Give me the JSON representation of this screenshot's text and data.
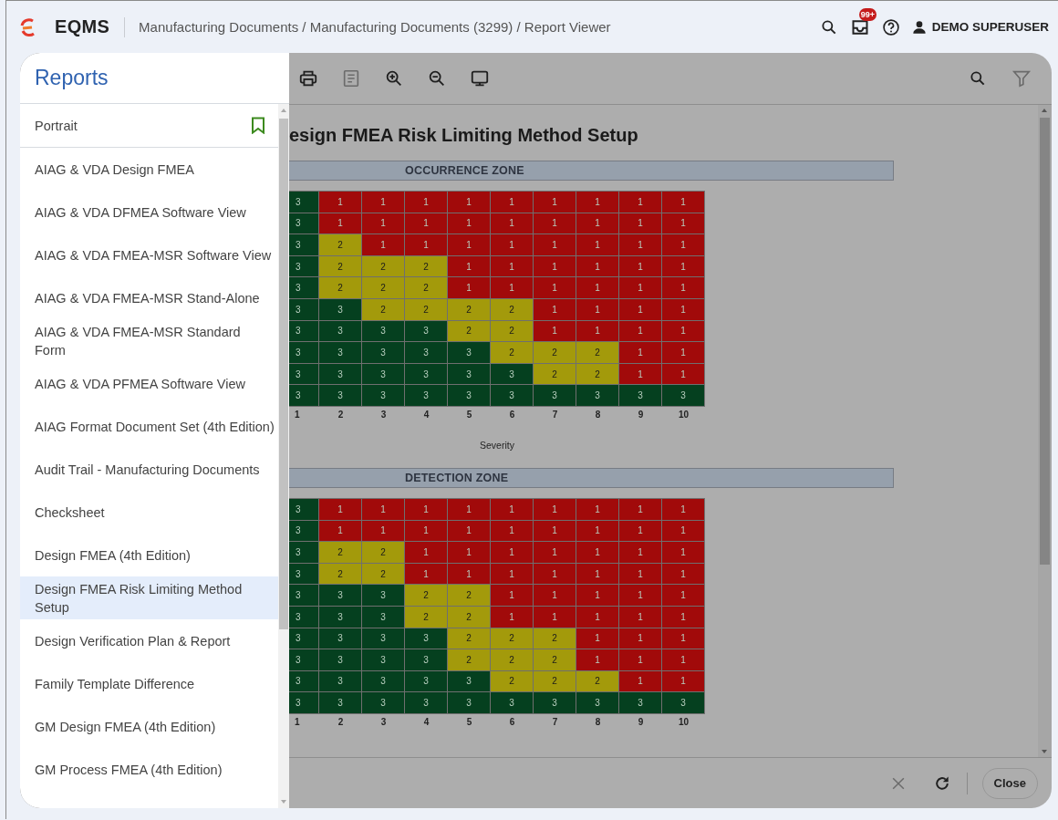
{
  "header": {
    "app_name": "EQMS",
    "breadcrumb": "Manufacturing Documents / Manufacturing Documents (3299) / Report Viewer",
    "notification_badge": "99+",
    "user_name": "DEMO SUPERUSER"
  },
  "reports_panel": {
    "title": "Reports",
    "orientation": "Portrait",
    "items": [
      {
        "label": "AIAG & VDA Design FMEA",
        "selected": false
      },
      {
        "label": "AIAG & VDA DFMEA Software View",
        "selected": false
      },
      {
        "label": "AIAG & VDA FMEA-MSR Software View",
        "selected": false
      },
      {
        "label": "AIAG & VDA FMEA-MSR Stand-Alone",
        "selected": false
      },
      {
        "label": "AIAG & VDA FMEA-MSR Standard Form",
        "selected": false
      },
      {
        "label": "AIAG & VDA PFMEA Software View",
        "selected": false
      },
      {
        "label": "AIAG Format Document Set (4th Edition)",
        "selected": false
      },
      {
        "label": "Audit Trail - Manufacturing Documents",
        "selected": false
      },
      {
        "label": "Checksheet",
        "selected": false
      },
      {
        "label": "Design FMEA (4th Edition)",
        "selected": false
      },
      {
        "label": "Design FMEA Risk Limiting Method Setup",
        "selected": true
      },
      {
        "label": "Design Verification Plan & Report",
        "selected": false
      },
      {
        "label": "Family Template Difference",
        "selected": false
      },
      {
        "label": "GM Design FMEA (4th Edition)",
        "selected": false
      },
      {
        "label": "GM Process FMEA (4th Edition)",
        "selected": false
      }
    ]
  },
  "report_viewer": {
    "toolbar": [
      {
        "kind": "print",
        "disabled": false
      },
      {
        "kind": "document",
        "disabled": true
      },
      {
        "kind": "zoom-in",
        "disabled": false
      },
      {
        "kind": "zoom-out",
        "disabled": false
      },
      {
        "kind": "monitor",
        "disabled": false
      }
    ],
    "toolbar_right": [
      {
        "kind": "search",
        "disabled": false
      },
      {
        "kind": "filter",
        "disabled": true
      }
    ],
    "title": "esign FMEA Risk Limiting Method Setup",
    "zones": [
      {
        "title": "OCCURRENCE ZONE",
        "axis_label": "Severity",
        "column_labels": [
          "1",
          "2",
          "3",
          "4",
          "5",
          "6",
          "7",
          "8",
          "9",
          "10"
        ],
        "rows": [
          [
            {
              "value": "3",
              "color": "#05401f"
            },
            {
              "value": "1",
              "color": "#a10a0a"
            },
            {
              "value": "1",
              "color": "#a10a0a"
            },
            {
              "value": "1",
              "color": "#a10a0a"
            },
            {
              "value": "1",
              "color": "#a10a0a"
            },
            {
              "value": "1",
              "color": "#a10a0a"
            },
            {
              "value": "1",
              "color": "#a10a0a"
            },
            {
              "value": "1",
              "color": "#a10a0a"
            },
            {
              "value": "1",
              "color": "#a10a0a"
            },
            {
              "value": "1",
              "color": "#a10a0a"
            }
          ],
          [
            {
              "value": "3",
              "color": "#05401f"
            },
            {
              "value": "1",
              "color": "#a10a0a"
            },
            {
              "value": "1",
              "color": "#a10a0a"
            },
            {
              "value": "1",
              "color": "#a10a0a"
            },
            {
              "value": "1",
              "color": "#a10a0a"
            },
            {
              "value": "1",
              "color": "#a10a0a"
            },
            {
              "value": "1",
              "color": "#a10a0a"
            },
            {
              "value": "1",
              "color": "#a10a0a"
            },
            {
              "value": "1",
              "color": "#a10a0a"
            },
            {
              "value": "1",
              "color": "#a10a0a"
            }
          ],
          [
            {
              "value": "3",
              "color": "#05401f"
            },
            {
              "value": "2",
              "color": "#a39a0b"
            },
            {
              "value": "1",
              "color": "#a10a0a"
            },
            {
              "value": "1",
              "color": "#a10a0a"
            },
            {
              "value": "1",
              "color": "#a10a0a"
            },
            {
              "value": "1",
              "color": "#a10a0a"
            },
            {
              "value": "1",
              "color": "#a10a0a"
            },
            {
              "value": "1",
              "color": "#a10a0a"
            },
            {
              "value": "1",
              "color": "#a10a0a"
            },
            {
              "value": "1",
              "color": "#a10a0a"
            }
          ],
          [
            {
              "value": "3",
              "color": "#05401f"
            },
            {
              "value": "2",
              "color": "#a39a0b"
            },
            {
              "value": "2",
              "color": "#a39a0b"
            },
            {
              "value": "2",
              "color": "#a39a0b"
            },
            {
              "value": "1",
              "color": "#a10a0a"
            },
            {
              "value": "1",
              "color": "#a10a0a"
            },
            {
              "value": "1",
              "color": "#a10a0a"
            },
            {
              "value": "1",
              "color": "#a10a0a"
            },
            {
              "value": "1",
              "color": "#a10a0a"
            },
            {
              "value": "1",
              "color": "#a10a0a"
            }
          ],
          [
            {
              "value": "3",
              "color": "#05401f"
            },
            {
              "value": "2",
              "color": "#a39a0b"
            },
            {
              "value": "2",
              "color": "#a39a0b"
            },
            {
              "value": "2",
              "color": "#a39a0b"
            },
            {
              "value": "1",
              "color": "#a10a0a"
            },
            {
              "value": "1",
              "color": "#a10a0a"
            },
            {
              "value": "1",
              "color": "#a10a0a"
            },
            {
              "value": "1",
              "color": "#a10a0a"
            },
            {
              "value": "1",
              "color": "#a10a0a"
            },
            {
              "value": "1",
              "color": "#a10a0a"
            }
          ],
          [
            {
              "value": "3",
              "color": "#05401f"
            },
            {
              "value": "3",
              "color": "#05401f"
            },
            {
              "value": "2",
              "color": "#a39a0b"
            },
            {
              "value": "2",
              "color": "#a39a0b"
            },
            {
              "value": "2",
              "color": "#a39a0b"
            },
            {
              "value": "2",
              "color": "#a39a0b"
            },
            {
              "value": "1",
              "color": "#a10a0a"
            },
            {
              "value": "1",
              "color": "#a10a0a"
            },
            {
              "value": "1",
              "color": "#a10a0a"
            },
            {
              "value": "1",
              "color": "#a10a0a"
            }
          ],
          [
            {
              "value": "3",
              "color": "#05401f"
            },
            {
              "value": "3",
              "color": "#05401f"
            },
            {
              "value": "3",
              "color": "#05401f"
            },
            {
              "value": "3",
              "color": "#05401f"
            },
            {
              "value": "2",
              "color": "#a39a0b"
            },
            {
              "value": "2",
              "color": "#a39a0b"
            },
            {
              "value": "1",
              "color": "#a10a0a"
            },
            {
              "value": "1",
              "color": "#a10a0a"
            },
            {
              "value": "1",
              "color": "#a10a0a"
            },
            {
              "value": "1",
              "color": "#a10a0a"
            }
          ],
          [
            {
              "value": "3",
              "color": "#05401f"
            },
            {
              "value": "3",
              "color": "#05401f"
            },
            {
              "value": "3",
              "color": "#05401f"
            },
            {
              "value": "3",
              "color": "#05401f"
            },
            {
              "value": "3",
              "color": "#05401f"
            },
            {
              "value": "2",
              "color": "#a39a0b"
            },
            {
              "value": "2",
              "color": "#a39a0b"
            },
            {
              "value": "2",
              "color": "#a39a0b"
            },
            {
              "value": "1",
              "color": "#a10a0a"
            },
            {
              "value": "1",
              "color": "#a10a0a"
            }
          ],
          [
            {
              "value": "3",
              "color": "#05401f"
            },
            {
              "value": "3",
              "color": "#05401f"
            },
            {
              "value": "3",
              "color": "#05401f"
            },
            {
              "value": "3",
              "color": "#05401f"
            },
            {
              "value": "3",
              "color": "#05401f"
            },
            {
              "value": "3",
              "color": "#05401f"
            },
            {
              "value": "2",
              "color": "#a39a0b"
            },
            {
              "value": "2",
              "color": "#a39a0b"
            },
            {
              "value": "1",
              "color": "#a10a0a"
            },
            {
              "value": "1",
              "color": "#a10a0a"
            }
          ],
          [
            {
              "value": "3",
              "color": "#05401f"
            },
            {
              "value": "3",
              "color": "#05401f"
            },
            {
              "value": "3",
              "color": "#05401f"
            },
            {
              "value": "3",
              "color": "#05401f"
            },
            {
              "value": "3",
              "color": "#05401f"
            },
            {
              "value": "3",
              "color": "#05401f"
            },
            {
              "value": "3",
              "color": "#05401f"
            },
            {
              "value": "3",
              "color": "#05401f"
            },
            {
              "value": "3",
              "color": "#05401f"
            },
            {
              "value": "3",
              "color": "#05401f"
            }
          ]
        ]
      },
      {
        "title": "DETECTION ZONE",
        "column_labels": [
          "1",
          "2",
          "3",
          "4",
          "5",
          "6",
          "7",
          "8",
          "9",
          "10"
        ],
        "rows": [
          [
            {
              "value": "3",
              "color": "#05401f"
            },
            {
              "value": "1",
              "color": "#a10a0a"
            },
            {
              "value": "1",
              "color": "#a10a0a"
            },
            {
              "value": "1",
              "color": "#a10a0a"
            },
            {
              "value": "1",
              "color": "#a10a0a"
            },
            {
              "value": "1",
              "color": "#a10a0a"
            },
            {
              "value": "1",
              "color": "#a10a0a"
            },
            {
              "value": "1",
              "color": "#a10a0a"
            },
            {
              "value": "1",
              "color": "#a10a0a"
            },
            {
              "value": "1",
              "color": "#a10a0a"
            }
          ],
          [
            {
              "value": "3",
              "color": "#05401f"
            },
            {
              "value": "1",
              "color": "#a10a0a"
            },
            {
              "value": "1",
              "color": "#a10a0a"
            },
            {
              "value": "1",
              "color": "#a10a0a"
            },
            {
              "value": "1",
              "color": "#a10a0a"
            },
            {
              "value": "1",
              "color": "#a10a0a"
            },
            {
              "value": "1",
              "color": "#a10a0a"
            },
            {
              "value": "1",
              "color": "#a10a0a"
            },
            {
              "value": "1",
              "color": "#a10a0a"
            },
            {
              "value": "1",
              "color": "#a10a0a"
            }
          ],
          [
            {
              "value": "3",
              "color": "#05401f"
            },
            {
              "value": "2",
              "color": "#a39a0b"
            },
            {
              "value": "2",
              "color": "#a39a0b"
            },
            {
              "value": "1",
              "color": "#a10a0a"
            },
            {
              "value": "1",
              "color": "#a10a0a"
            },
            {
              "value": "1",
              "color": "#a10a0a"
            },
            {
              "value": "1",
              "color": "#a10a0a"
            },
            {
              "value": "1",
              "color": "#a10a0a"
            },
            {
              "value": "1",
              "color": "#a10a0a"
            },
            {
              "value": "1",
              "color": "#a10a0a"
            }
          ],
          [
            {
              "value": "3",
              "color": "#05401f"
            },
            {
              "value": "2",
              "color": "#a39a0b"
            },
            {
              "value": "2",
              "color": "#a39a0b"
            },
            {
              "value": "1",
              "color": "#a10a0a"
            },
            {
              "value": "1",
              "color": "#a10a0a"
            },
            {
              "value": "1",
              "color": "#a10a0a"
            },
            {
              "value": "1",
              "color": "#a10a0a"
            },
            {
              "value": "1",
              "color": "#a10a0a"
            },
            {
              "value": "1",
              "color": "#a10a0a"
            },
            {
              "value": "1",
              "color": "#a10a0a"
            }
          ],
          [
            {
              "value": "3",
              "color": "#05401f"
            },
            {
              "value": "3",
              "color": "#05401f"
            },
            {
              "value": "3",
              "color": "#05401f"
            },
            {
              "value": "2",
              "color": "#a39a0b"
            },
            {
              "value": "2",
              "color": "#a39a0b"
            },
            {
              "value": "1",
              "color": "#a10a0a"
            },
            {
              "value": "1",
              "color": "#a10a0a"
            },
            {
              "value": "1",
              "color": "#a10a0a"
            },
            {
              "value": "1",
              "color": "#a10a0a"
            },
            {
              "value": "1",
              "color": "#a10a0a"
            }
          ],
          [
            {
              "value": "3",
              "color": "#05401f"
            },
            {
              "value": "3",
              "color": "#05401f"
            },
            {
              "value": "3",
              "color": "#05401f"
            },
            {
              "value": "2",
              "color": "#a39a0b"
            },
            {
              "value": "2",
              "color": "#a39a0b"
            },
            {
              "value": "1",
              "color": "#a10a0a"
            },
            {
              "value": "1",
              "color": "#a10a0a"
            },
            {
              "value": "1",
              "color": "#a10a0a"
            },
            {
              "value": "1",
              "color": "#a10a0a"
            },
            {
              "value": "1",
              "color": "#a10a0a"
            }
          ],
          [
            {
              "value": "3",
              "color": "#05401f"
            },
            {
              "value": "3",
              "color": "#05401f"
            },
            {
              "value": "3",
              "color": "#05401f"
            },
            {
              "value": "3",
              "color": "#05401f"
            },
            {
              "value": "2",
              "color": "#a39a0b"
            },
            {
              "value": "2",
              "color": "#a39a0b"
            },
            {
              "value": "2",
              "color": "#a39a0b"
            },
            {
              "value": "1",
              "color": "#a10a0a"
            },
            {
              "value": "1",
              "color": "#a10a0a"
            },
            {
              "value": "1",
              "color": "#a10a0a"
            }
          ],
          [
            {
              "value": "3",
              "color": "#05401f"
            },
            {
              "value": "3",
              "color": "#05401f"
            },
            {
              "value": "3",
              "color": "#05401f"
            },
            {
              "value": "3",
              "color": "#05401f"
            },
            {
              "value": "2",
              "color": "#a39a0b"
            },
            {
              "value": "2",
              "color": "#a39a0b"
            },
            {
              "value": "2",
              "color": "#a39a0b"
            },
            {
              "value": "1",
              "color": "#a10a0a"
            },
            {
              "value": "1",
              "color": "#a10a0a"
            },
            {
              "value": "1",
              "color": "#a10a0a"
            }
          ],
          [
            {
              "value": "3",
              "color": "#05401f"
            },
            {
              "value": "3",
              "color": "#05401f"
            },
            {
              "value": "3",
              "color": "#05401f"
            },
            {
              "value": "3",
              "color": "#05401f"
            },
            {
              "value": "3",
              "color": "#05401f"
            },
            {
              "value": "2",
              "color": "#a39a0b"
            },
            {
              "value": "2",
              "color": "#a39a0b"
            },
            {
              "value": "2",
              "color": "#a39a0b"
            },
            {
              "value": "1",
              "color": "#a10a0a"
            },
            {
              "value": "1",
              "color": "#a10a0a"
            }
          ],
          [
            {
              "value": "3",
              "color": "#05401f"
            },
            {
              "value": "3",
              "color": "#05401f"
            },
            {
              "value": "3",
              "color": "#05401f"
            },
            {
              "value": "3",
              "color": "#05401f"
            },
            {
              "value": "3",
              "color": "#05401f"
            },
            {
              "value": "3",
              "color": "#05401f"
            },
            {
              "value": "3",
              "color": "#05401f"
            },
            {
              "value": "3",
              "color": "#05401f"
            },
            {
              "value": "3",
              "color": "#05401f"
            },
            {
              "value": "3",
              "color": "#05401f"
            }
          ]
        ]
      }
    ],
    "footer_actions": [
      {
        "kind": "clear",
        "disabled": true
      },
      {
        "kind": "refresh",
        "disabled": false
      }
    ],
    "close_button": "Close"
  }
}
